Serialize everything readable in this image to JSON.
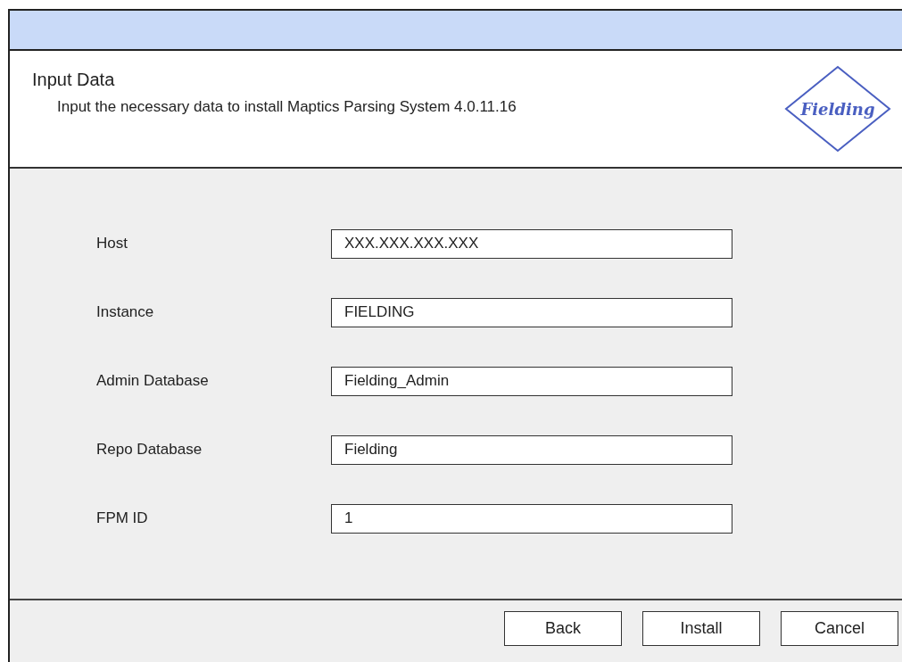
{
  "header": {
    "title": "Input Data",
    "description": "Input the necessary data to install Maptics Parsing System 4.0.11.16",
    "logo": "Fielding"
  },
  "fields": [
    {
      "label": "Host",
      "value": "XXX.XXX.XXX.XXX"
    },
    {
      "label": "Instance",
      "value": "FIELDING"
    },
    {
      "label": "Admin Database",
      "value": "Fielding_Admin"
    },
    {
      "label": "Repo Database",
      "value": "Fielding"
    },
    {
      "label": "FPM ID",
      "value": "1"
    }
  ],
  "buttons": [
    "Back",
    "Install",
    "Cancel"
  ]
}
